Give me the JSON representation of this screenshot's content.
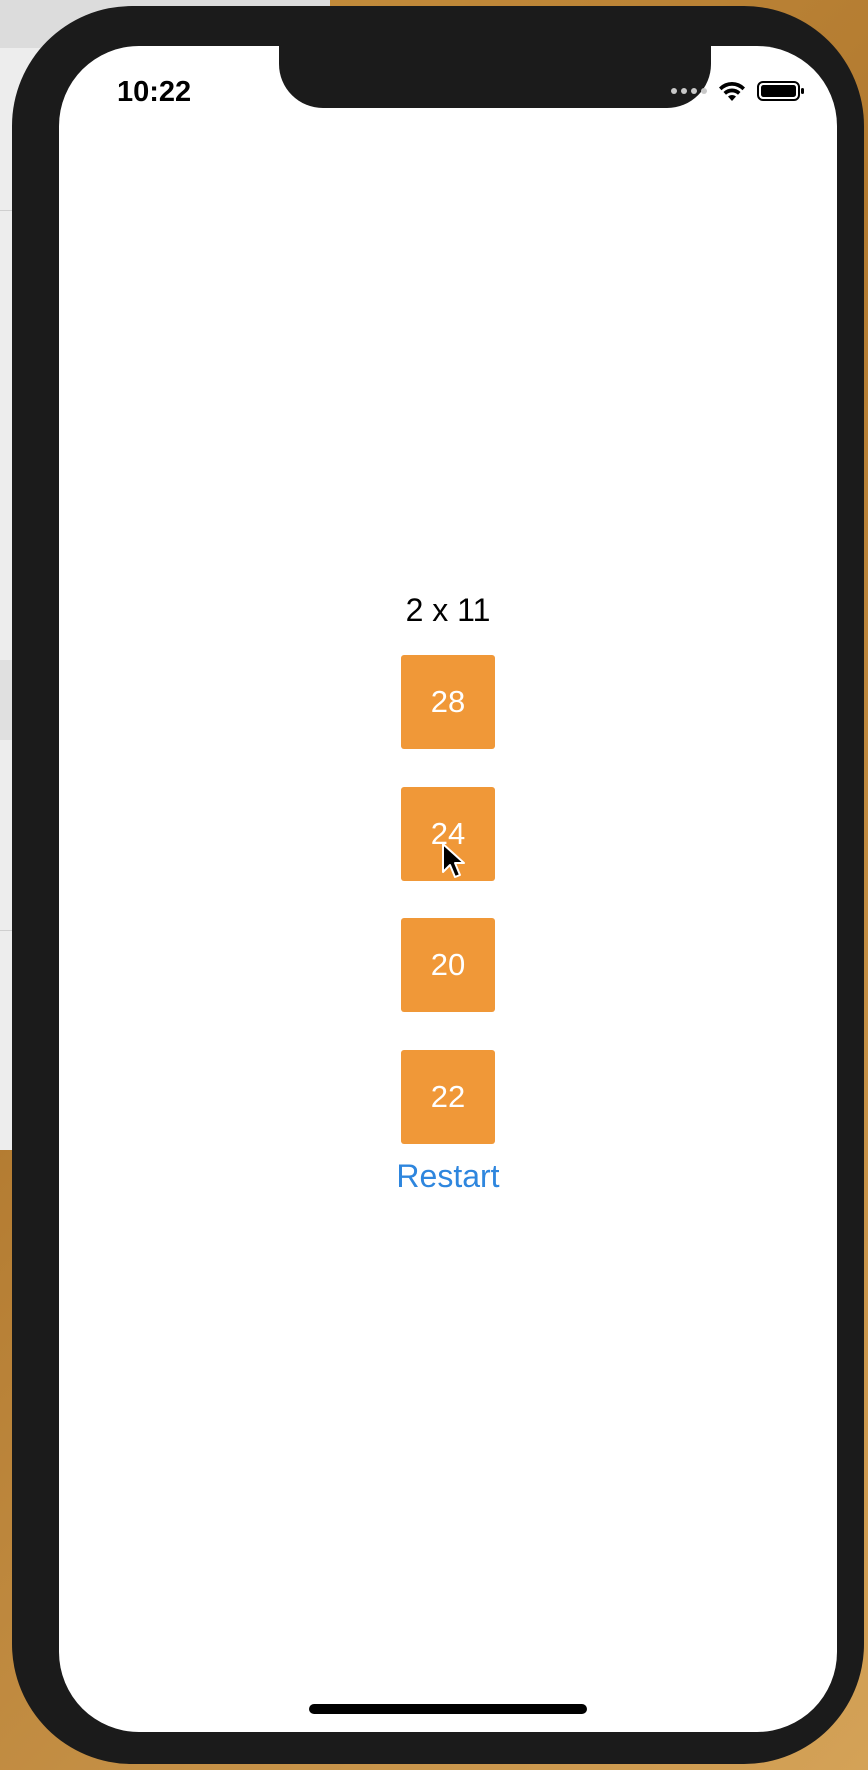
{
  "status_bar": {
    "time": "10:22"
  },
  "question": {
    "text": "2 x 11"
  },
  "answers": [
    {
      "label": "28"
    },
    {
      "label": "24"
    },
    {
      "label": "20"
    },
    {
      "label": "22"
    }
  ],
  "restart_label": "Restart",
  "colors": {
    "answer_bg": "#f09838",
    "answer_text": "#ffffff",
    "link": "#2e86de",
    "frame": "#1b1b1b"
  },
  "icons": [
    "wifi-icon",
    "battery-icon",
    "signal-icon",
    "cursor-icon"
  ]
}
